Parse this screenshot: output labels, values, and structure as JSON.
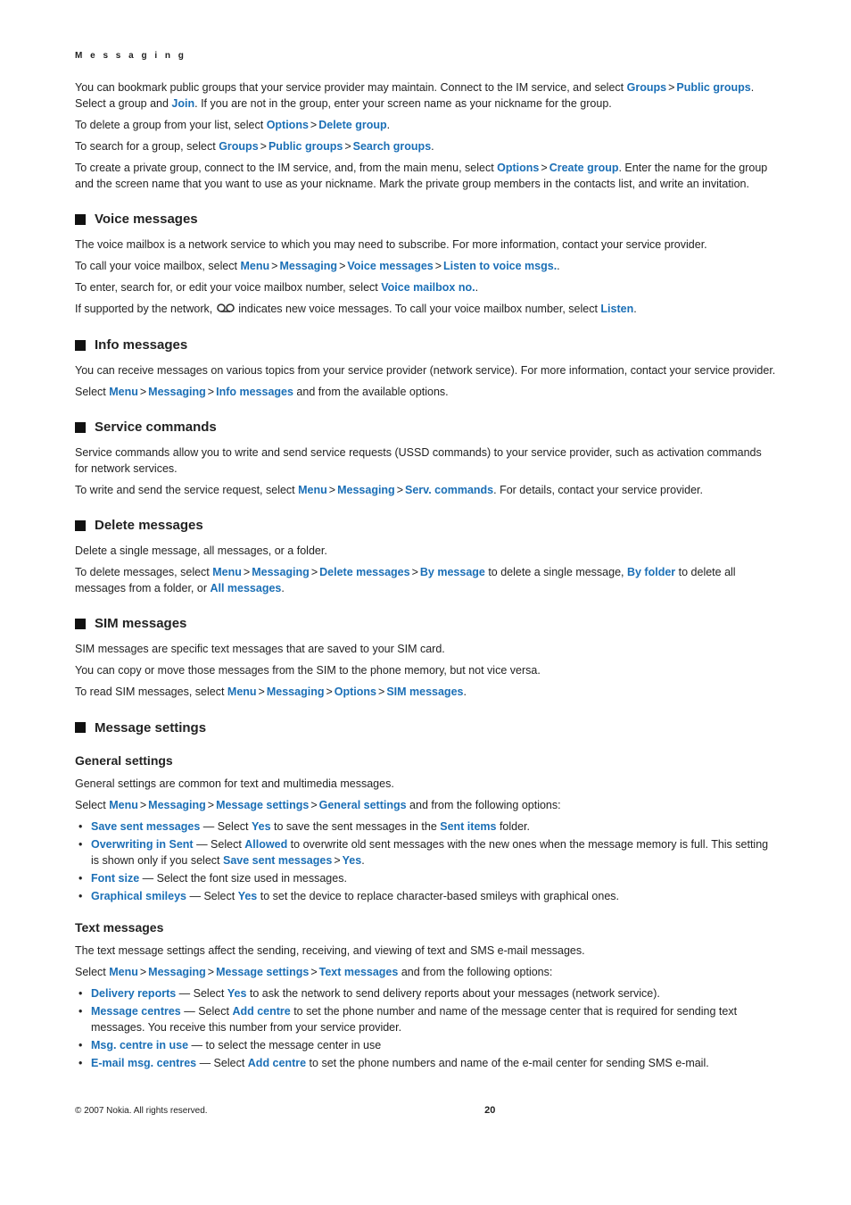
{
  "header": "M e s s a g i n g",
  "intro": {
    "p1a": "You can bookmark public groups that your service provider may maintain. Connect to the IM service, and select ",
    "groups": "Groups",
    "public_groups": "Public groups",
    "p1b": ". Select a group and ",
    "join": "Join",
    "p1c": ". If you are not in the group, enter your screen name as your nickname for the group.",
    "p2a": "To delete a group from your list, select ",
    "options": "Options",
    "delete_group": "Delete group",
    "p3a": "To search for a group, select ",
    "search_groups": "Search groups",
    "p4a": "To create a private group, connect to the IM service, and, from the main menu, select ",
    "create_group": "Create group",
    "p4b": ". Enter the name for the group and the screen name that you want to use as your nickname. Mark the private group members in the contacts list, and write an invitation."
  },
  "voice": {
    "title": "Voice messages",
    "p1": "The voice mailbox is a network service to which you may need to subscribe. For more information, contact your service provider.",
    "p2a": "To call your voice mailbox, select ",
    "menu": "Menu",
    "messaging": "Messaging",
    "voice_messages": "Voice messages",
    "listen_to": "Listen to voice msgs.",
    "p3a": "To enter, search for, or edit your voice mailbox number, select ",
    "voice_mailbox_no": "Voice mailbox no.",
    "p4a": "If supported by the network, ",
    "p4b": " indicates new voice messages. To call your voice mailbox number, select ",
    "listen": "Listen"
  },
  "info": {
    "title": "Info messages",
    "p1": "You can receive messages on various topics from your service provider (network service). For more information, contact your service provider.",
    "p2a": "Select ",
    "info_messages": "Info messages",
    "p2b": " and from the available options."
  },
  "service": {
    "title": "Service commands",
    "p1": "Service commands allow you to write and send service requests (USSD commands) to your service provider, such as activation commands for network services.",
    "p2a": "To write and send the service request, select ",
    "serv_commands": "Serv. commands",
    "p2b": ". For details, contact your service provider."
  },
  "delete": {
    "title": "Delete messages",
    "p1": "Delete a single message, all messages, or a folder.",
    "p2a": "To delete messages, select ",
    "delete_messages": "Delete messages",
    "by_message": "By message",
    "p2b": " to delete a single message, ",
    "by_folder": "By folder",
    "p2c": " to delete all messages from a folder, or ",
    "all_messages": "All messages"
  },
  "sim": {
    "title": "SIM messages",
    "p1": "SIM messages are specific text messages that are saved to your SIM card.",
    "p2": "You can copy or move those messages from the SIM to the phone memory, but not vice versa.",
    "p3a": "To read SIM messages, select ",
    "sim_messages": "SIM messages"
  },
  "settings": {
    "title": "Message settings",
    "general": {
      "title": "General settings",
      "p1": "General settings are common for text and multimedia messages.",
      "p2a": "Select ",
      "message_settings": "Message settings",
      "general_settings": "General settings",
      "p2b": " and from the following options:",
      "b1_label": "Save sent messages",
      "b1a": " — Select ",
      "yes": "Yes",
      "b1b": " to save the sent messages in the ",
      "sent_items": "Sent items",
      "b1c": " folder.",
      "b2_label": "Overwriting in Sent",
      "b2a": " — Select ",
      "allowed": "Allowed",
      "b2b": " to overwrite old sent messages with the new ones when the message memory is full. This setting is shown only if you select ",
      "b3_label": "Font size",
      "b3a": " — Select the font size used in messages.",
      "b4_label": "Graphical smileys",
      "b4a": " — Select ",
      "b4b": " to set the device to replace character-based smileys with graphical ones."
    },
    "text": {
      "title": "Text messages",
      "p1": "The text message settings affect the sending, receiving, and viewing of text and SMS e-mail messages.",
      "p2a": "Select ",
      "text_messages": "Text messages",
      "p2b": " and from the following options:",
      "b1_label": "Delivery reports",
      "b1a": " — Select ",
      "b1b": " to ask the network to send delivery reports about your messages (network service).",
      "b2_label": "Message centres",
      "b2a": " — Select ",
      "add_centre": "Add centre",
      "b2b": " to set the phone number and name of the message center that is required for sending text messages. You receive this number from your service provider.",
      "b3_label": "Msg. centre in use",
      "b3a": " — to select the message center in use",
      "b4_label": "E-mail msg. centres",
      "b4a": " — Select ",
      "b4b": " to set the phone numbers and name of the e-mail center for sending SMS e-mail."
    }
  },
  "footer": {
    "copyright": "© 2007 Nokia. All rights reserved.",
    "page": "20"
  }
}
